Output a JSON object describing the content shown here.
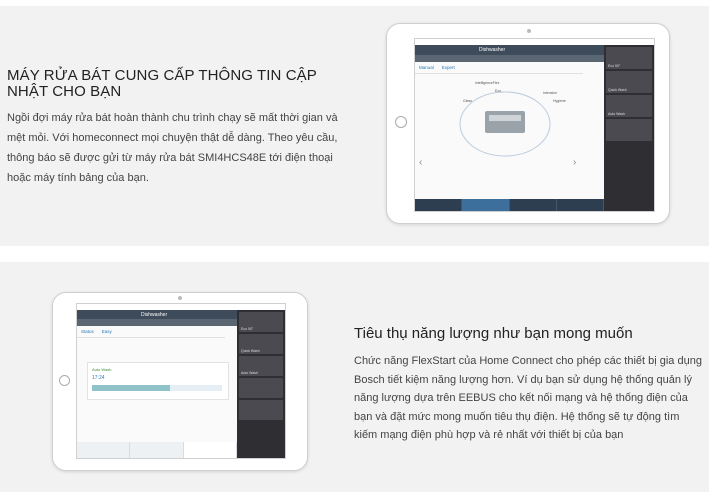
{
  "section1": {
    "heading": "MÁY RỬA BÁT CUNG CẤP THÔNG TIN CẬP NHẬT CHO BẠN",
    "body": "Ngồi đợi máy rửa bát hoàn thành chu trình chạy sẽ mất thời gian và mệt mỏi. Với homeconnect mọi chuyện thật dễ dàng. Theo yêu cầu, thông báo sẽ được gửi từ máy rửa bát SMI4HCS48E tới điện thoại hoặc máy tính bảng của bạn."
  },
  "section2": {
    "heading": "Tiêu thụ năng lượng như bạn mong muốn",
    "body": "Chức năng FlexStart của Home Connect cho phép các thiết bị gia dụng Bosch tiết kiệm năng lượng hơn. Ví dụ bạn sử dụng hệ thống quản lý năng lượng dựa trên EEBUS cho kết nối mạng và hệ thống điện của bạn và đặt mức mong muốn tiêu thụ điện. Hệ thống sẽ tự động tìm kiếm mạng điện phù hợp và rẻ nhất với thiết bị của bạn"
  },
  "tablet1": {
    "app_title": "Dishwasher",
    "tabs": [
      "Manual",
      "Expert"
    ],
    "options": [
      "IntelligenceFlex",
      "Glass",
      "Eco",
      "Intensive",
      "Hygiene"
    ],
    "sidebar": [
      "Eco 50°",
      "Quick Wash",
      "Auto Wash"
    ]
  },
  "tablet2": {
    "app_title": "Dishwasher",
    "tabs": [
      "Status",
      "Easy"
    ],
    "status_label": "Auto Wash",
    "time": "17:24",
    "sidebar": [
      "Eco 50°",
      "Quick Wash",
      "Auto Wash"
    ]
  }
}
